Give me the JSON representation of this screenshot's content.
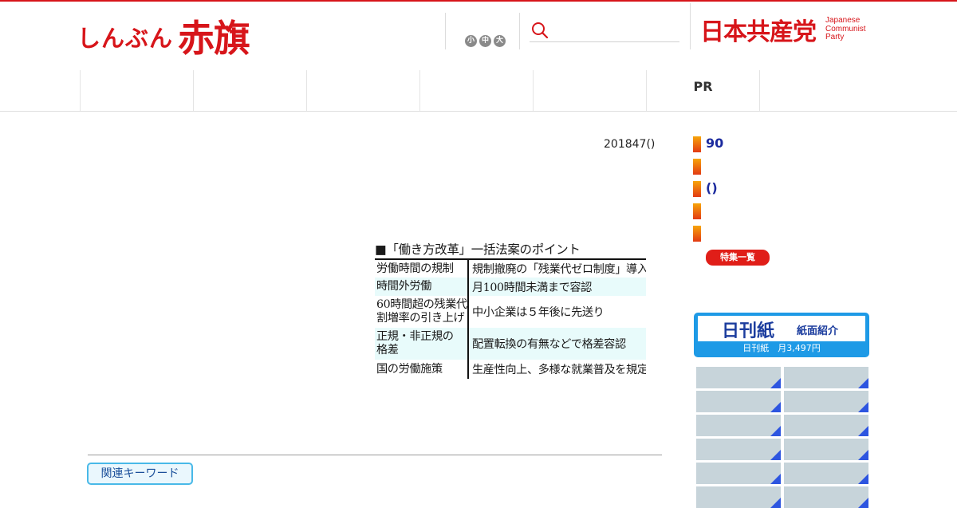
{
  "header": {
    "logo_small": "しんぶん",
    "logo_big": "赤旗",
    "font_sizes": [
      "小",
      "中",
      "大"
    ],
    "search": {
      "placeholder": ""
    },
    "party_name": "日本共産党",
    "party_name_en": [
      "Japanese",
      "Communist",
      "Party"
    ]
  },
  "nav": {
    "tabs": [
      "",
      "",
      "",
      "",
      "",
      "PR",
      ""
    ]
  },
  "article": {
    "date": "201847()",
    "table": {
      "title": "■「働き方改革」一括法案のポイント",
      "rows": [
        {
          "item": [
            "労働時間の規制"
          ],
          "detail": "規制撤廃の「残業代ゼロ制度」導入"
        },
        {
          "item": [
            "時間外労働"
          ],
          "detail": "月100時間未満まで容認"
        },
        {
          "item": [
            "60時間超の残業代",
            "割増率の引き上げ"
          ],
          "detail": "中小企業は５年後に先送り"
        },
        {
          "item": [
            "正規・非正規の",
            "格差"
          ],
          "detail": "配置転換の有無などで格差容認"
        },
        {
          "item": [
            "国の労働施策"
          ],
          "detail": "生産性向上、多様な就業普及を規定"
        }
      ]
    },
    "related_keywords_label": "関連キーワード"
  },
  "sidebar": {
    "items": [
      "90",
      "",
      "()",
      "",
      ""
    ],
    "feature_list_label": "特集一覧",
    "nikkan": {
      "title": "日刊紙",
      "subtitle": "紙面紹介",
      "price": "日刊紙　月3,497円"
    }
  },
  "colors": {
    "brand_red": "#d7151a",
    "link_blue": "#1b2a9e",
    "nikkan_blue": "#1e9ae6",
    "thumb_corner": "#2d55e0"
  }
}
